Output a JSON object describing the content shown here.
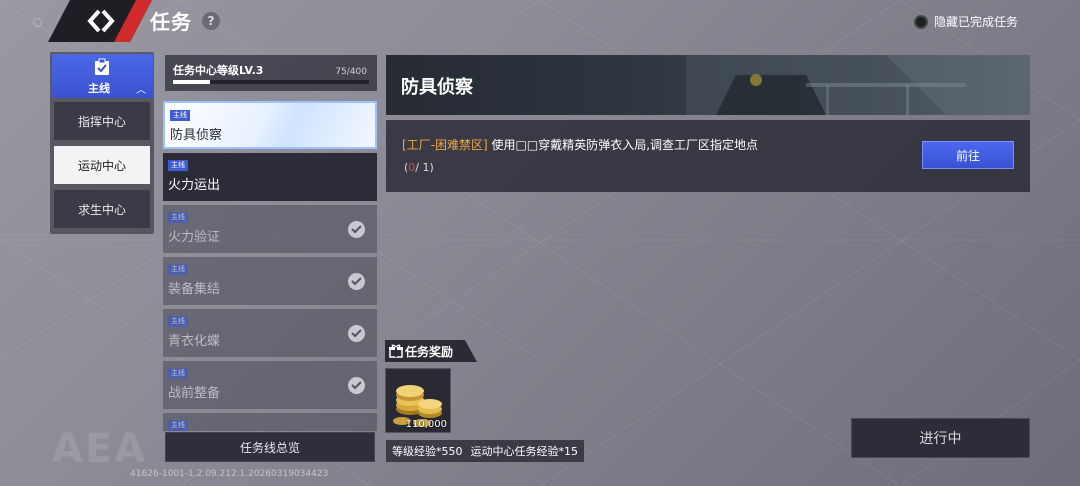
{
  "header": {
    "title": "任务",
    "help_icon": "?",
    "hide_completed_label": "隐藏已完成任务"
  },
  "categories": {
    "main": {
      "label": "主线",
      "icon": "clipboard-icon"
    },
    "items": [
      {
        "label": "指挥中心",
        "active": false
      },
      {
        "label": "运动中心",
        "active": true
      },
      {
        "label": "求生中心",
        "active": false
      }
    ]
  },
  "level": {
    "title": "任务中心等级LV.3",
    "count": "75/400",
    "progress": 0.1875
  },
  "quests": [
    {
      "tag": "主线",
      "name": "防具侦察",
      "state": "selected"
    },
    {
      "tag": "主线",
      "name": "火力运出",
      "state": "current"
    },
    {
      "tag": "主线",
      "name": "火力验证",
      "state": "done"
    },
    {
      "tag": "主线",
      "name": "装备集结",
      "state": "done"
    },
    {
      "tag": "主线",
      "name": "青衣化蝶",
      "state": "done"
    },
    {
      "tag": "主线",
      "name": "战前整备",
      "state": "done"
    },
    {
      "tag": "主线",
      "name": "",
      "state": "done"
    }
  ],
  "overview_button": "任务线总览",
  "detail": {
    "title": "防具侦察",
    "objective_location": "[工厂-困难禁区]",
    "objective_text": "使用□□穿戴精英防弹衣入局,调查工厂区指定地点",
    "progress_open": "(",
    "progress_current": "0",
    "progress_rest": "/ 1)",
    "goto_button": "前往"
  },
  "rewards": {
    "title": "任务奖励",
    "item_count": "110,000",
    "exp_1": "等级经验*550",
    "exp_2": "运动中心任务经验*15"
  },
  "status_button": "进行中",
  "watermark": "AEA",
  "build_id": "41626-1001-1.2.09.212.1.20260319034423",
  "colors": {
    "accent_blue": "#3f5bd6",
    "location_orange": "#f0a640",
    "progress_red": "#e04848"
  }
}
